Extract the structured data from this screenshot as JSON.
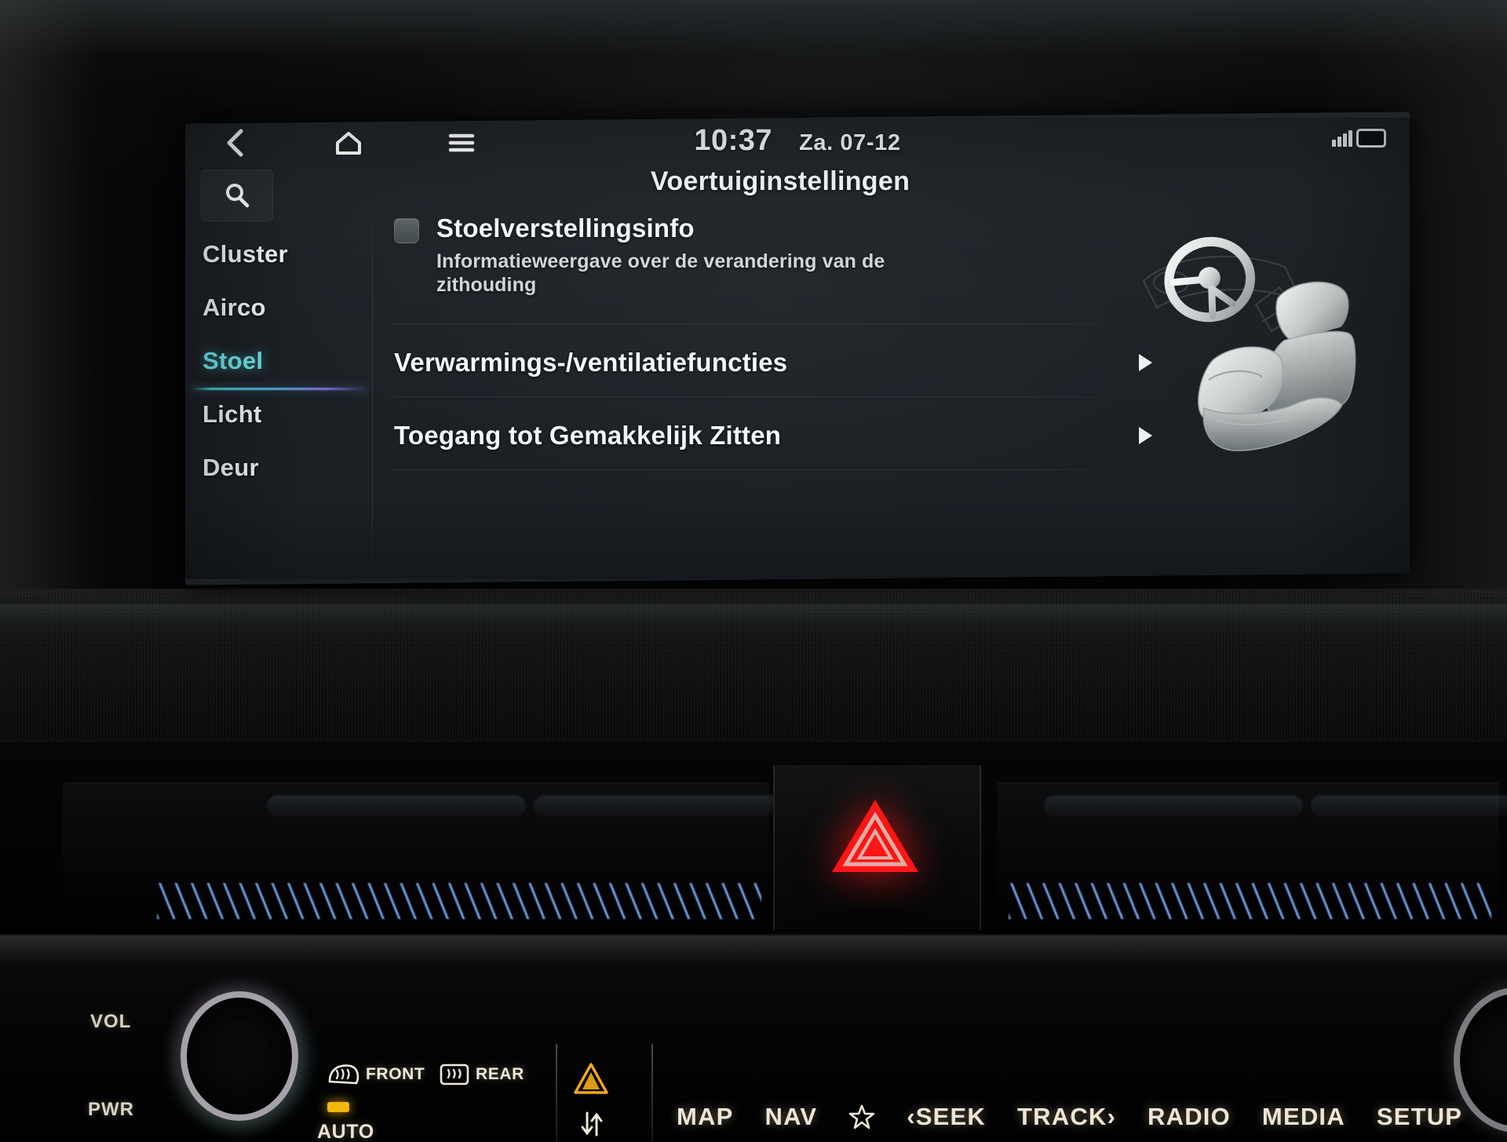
{
  "screen": {
    "statusbar": {
      "back_icon": "chevron-left-icon",
      "home_icon": "home-icon",
      "menu_icon": "hamburger-menu-icon",
      "time": "10:37",
      "date": "Za. 07-12",
      "signal_icon": "signal-strength-icon",
      "battery_icon": "battery-icon"
    },
    "search": {
      "icon": "search-icon",
      "label": ""
    },
    "page_title": "Voertuiginstellingen",
    "sidebar": {
      "items": [
        {
          "label": "Cluster",
          "active": false
        },
        {
          "label": "Airco",
          "active": false
        },
        {
          "label": "Stoel",
          "active": true
        },
        {
          "label": "Licht",
          "active": false
        },
        {
          "label": "Deur",
          "active": false
        }
      ],
      "active_color": "#6fe3e8",
      "underline_gradient": [
        "#46e1e4",
        "#5ac8eb",
        "#8c6ef0"
      ]
    },
    "content": {
      "rows": [
        {
          "type": "toggle",
          "label": "Stoelverstellingsinfo",
          "description": "Informatieweergave over de verandering van de zithouding",
          "checked": false
        },
        {
          "type": "link",
          "label": "Verwarmings-/ventilatiefuncties",
          "caret": "caret-right-icon"
        },
        {
          "type": "link",
          "label": "Toegang tot Gemakkelijk Zitten",
          "caret": "caret-right-icon"
        }
      ]
    },
    "illustration": "car-seat-and-steering-wheel-illustration"
  },
  "console": {
    "hazard": {
      "icon": "hazard-warning-triangle-icon",
      "color": "#ff1a1a"
    },
    "ambient_light_color": "#78afff",
    "volume_knob": {
      "top_label": "VOL",
      "bottom_label": "PWR"
    },
    "climate": {
      "front_defrost_label": "FRONT",
      "front_defrost_icon": "defrost-front-icon",
      "rear_defrost_label": "REAR",
      "rear_defrost_icon": "defrost-rear-icon",
      "auto_label": "AUTO",
      "auto_led_color": "#f2b60c",
      "warning_icon": "warning-triangle-icon",
      "recirculation_icon": "air-recirculation-icon"
    },
    "function_buttons": [
      {
        "label": "MAP",
        "icon": null
      },
      {
        "label": "NAV",
        "icon": null
      },
      {
        "label": "",
        "icon": "star-favorite-icon"
      },
      {
        "label": "‹SEEK",
        "icon": null
      },
      {
        "label": "TRACK›",
        "icon": null
      },
      {
        "label": "RADIO",
        "icon": null
      },
      {
        "label": "MEDIA",
        "icon": null
      },
      {
        "label": "SETUP",
        "icon": null
      }
    ]
  }
}
